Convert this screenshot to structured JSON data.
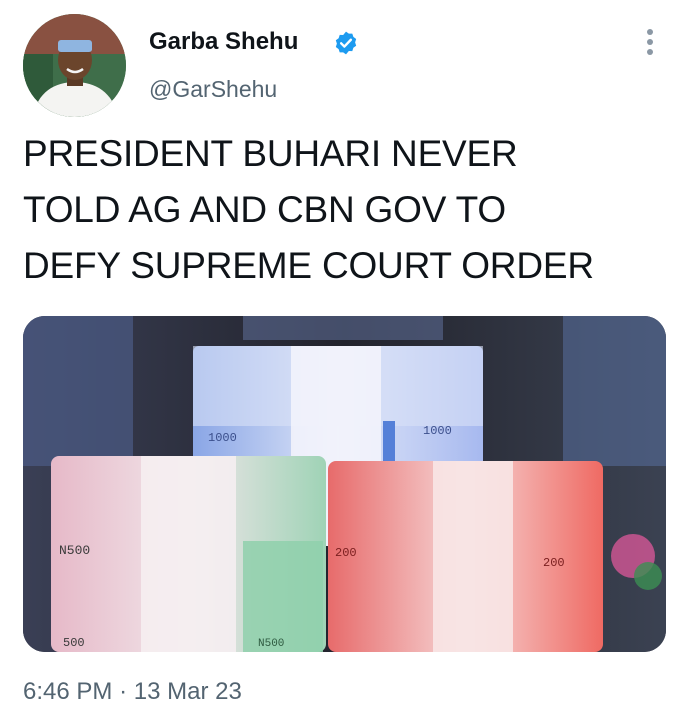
{
  "tweet": {
    "author_name": "Garba Shehu",
    "handle": "@GarShehu",
    "verified": true,
    "avatar_icon": "profile-photo",
    "menu_icon": "more-options-icon",
    "text_lines": [
      "PRESIDENT BUHARI NEVER",
      "TOLD AG AND CBN GOV TO",
      "DEFY SUPREME COURT ORDER"
    ],
    "time": "6:46 PM",
    "separator": "·",
    "date": "13 Mar 23",
    "media": {
      "kind": "photo",
      "note_labels": {
        "top_left": "1000",
        "top_right": "1000",
        "left_stack_top": "N500",
        "left_stack_bottom": "500",
        "left_stack_corner": "N500",
        "right_stack_top": "200",
        "right_stack_right": "200"
      }
    }
  },
  "colors": {
    "verified_blue": "#1d9bf0",
    "secondary_text": "#536471"
  }
}
